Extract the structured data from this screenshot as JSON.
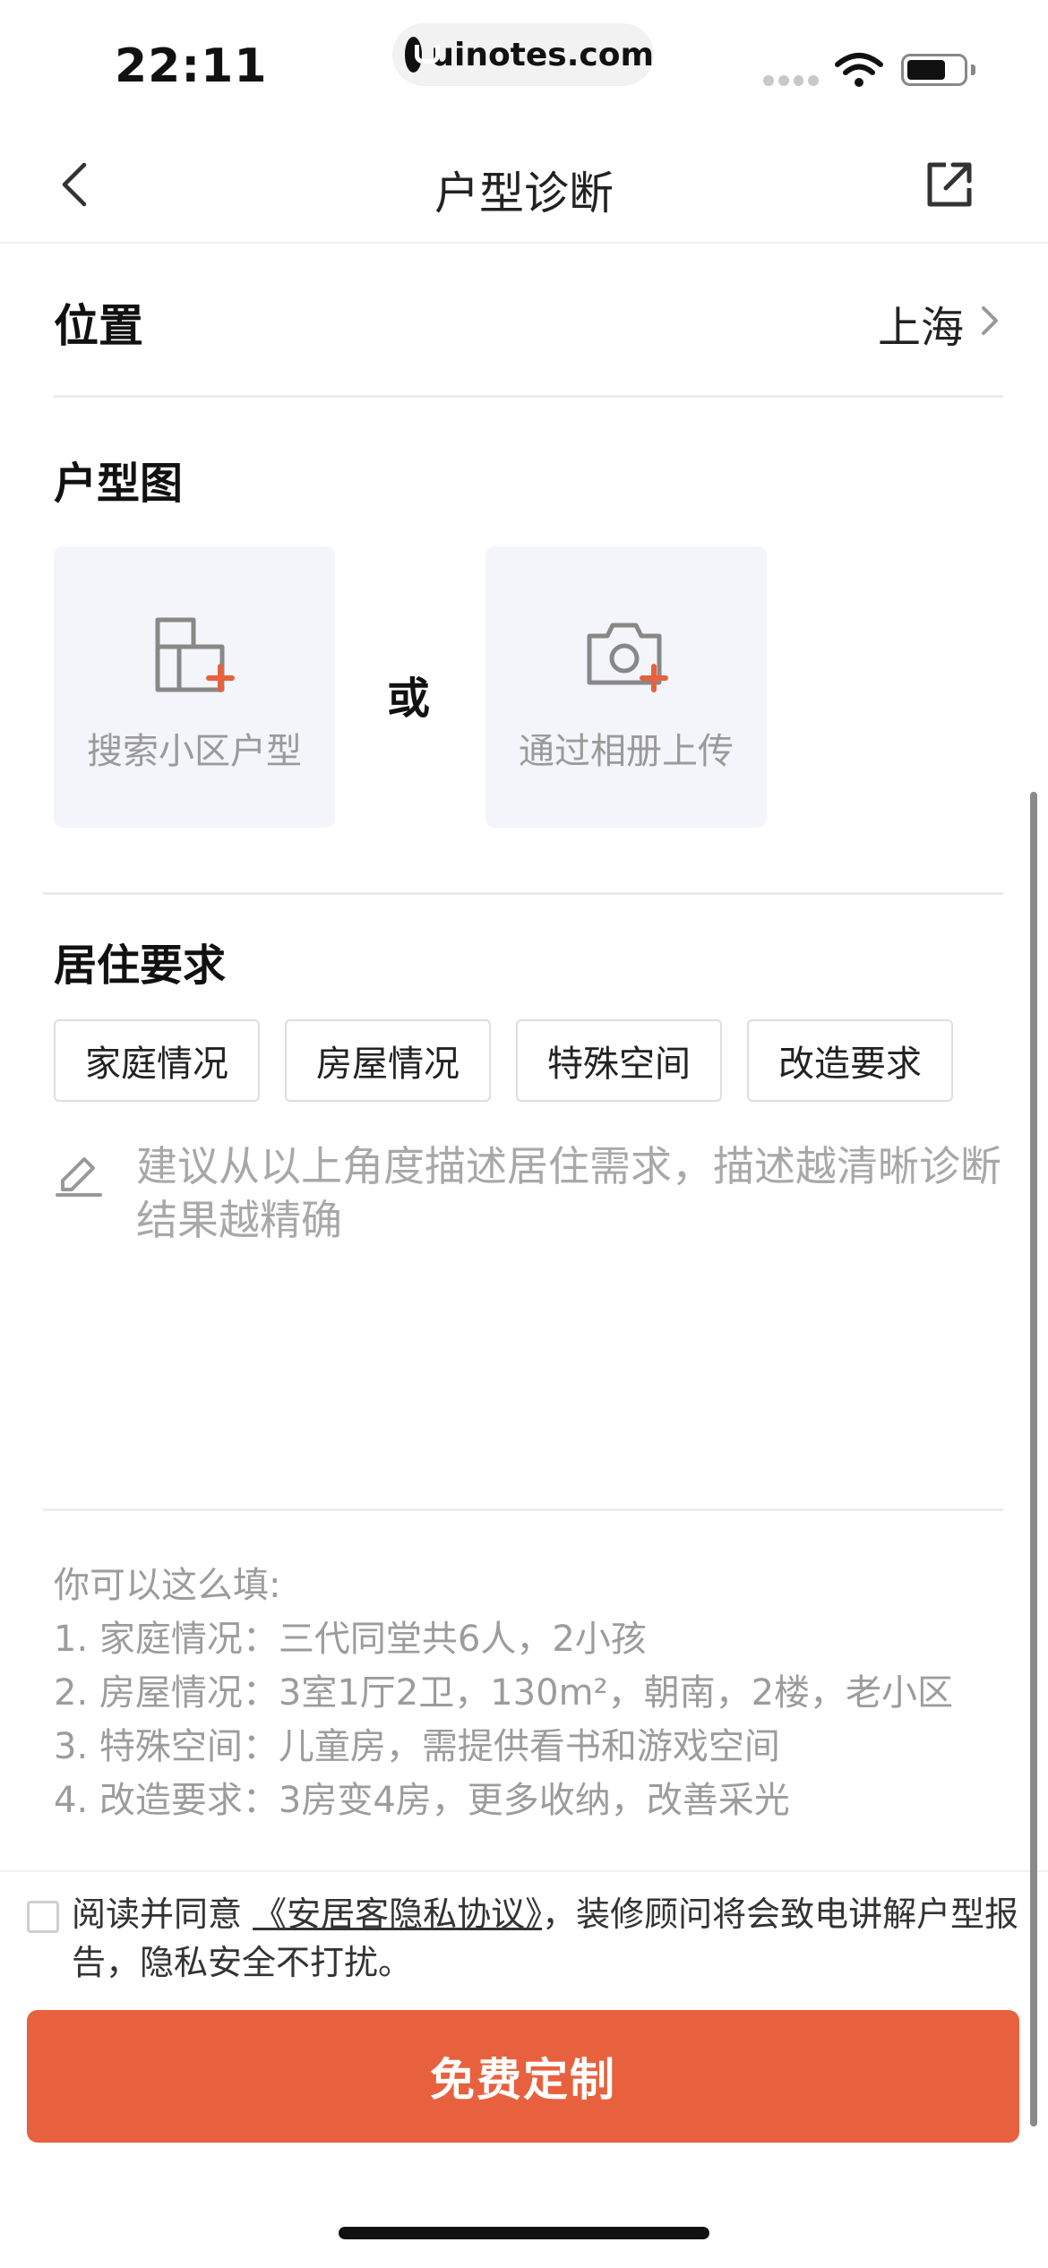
{
  "status_bar": {
    "time": "22:11",
    "url": "uinotes.com"
  },
  "nav": {
    "title": "户型诊断"
  },
  "location": {
    "label": "位置",
    "value": "上海"
  },
  "floor_plan": {
    "title": "户型图",
    "search_label": "搜索小区户型",
    "or_text": "或",
    "upload_label": "通过相册上传"
  },
  "requirements": {
    "title": "居住要求",
    "tags": [
      "家庭情况",
      "房屋情况",
      "特殊空间",
      "改造要求"
    ],
    "placeholder": "建议从以上角度描述居住需求，描述越清晰诊断结果越精确"
  },
  "example": {
    "heading": "你可以这么填:",
    "lines": [
      "1. 家庭情况：三代同堂共6人，2小孩",
      "2. 房屋情况：3室1厅2卫，130m²，朝南，2楼，老小区",
      "3. 特殊空间：儿童房，需提供看书和游戏空间",
      "4. 改造要求：3房变4房，更多收纳，改善采光"
    ]
  },
  "agreement": {
    "prefix": "阅读并同意 ",
    "link": "《安居客隐私协议》",
    "suffix": "，装修顾问将会致电讲解户型报告，隐私安全不打扰。"
  },
  "submit": {
    "label": "免费定制"
  },
  "colors": {
    "accent": "#e8613e",
    "card_bg": "#f4f5fa"
  }
}
